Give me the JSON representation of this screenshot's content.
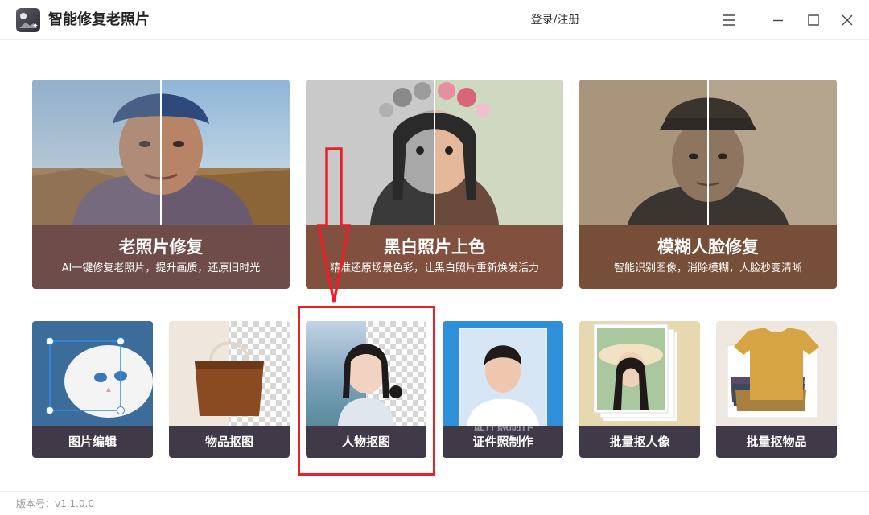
{
  "app": {
    "title": "智能修复老照片",
    "login_label": "登录/注册",
    "version": "版本号：v1.1.0.0"
  },
  "window_controls": [
    "menu-icon",
    "minimize-icon",
    "maximize-icon",
    "close-icon"
  ],
  "features": [
    {
      "title": "老照片修复",
      "subtitle": "AI一键修复老照片，提升画质，还原旧时光",
      "panel_color": "#6e4c4a"
    },
    {
      "title": "黑白照片上色",
      "subtitle": "精准还原场景色彩，让黑白照片重新焕发活力",
      "panel_color": "#82503e"
    },
    {
      "title": "模糊人脸修复",
      "subtitle": "智能识别图像，消除模糊，人脸秒变清晰",
      "panel_color": "#774f39"
    }
  ],
  "tools": [
    {
      "label": "图片编辑"
    },
    {
      "label": "物品抠图"
    },
    {
      "label": "人物抠图"
    },
    {
      "label": "证件照制作",
      "overlay_text": "证件照制作"
    },
    {
      "label": "批量抠人像"
    },
    {
      "label": "批量抠物品"
    }
  ],
  "annotation": {
    "highlighted_tool": "人物抠图",
    "color": "#e8202a"
  }
}
